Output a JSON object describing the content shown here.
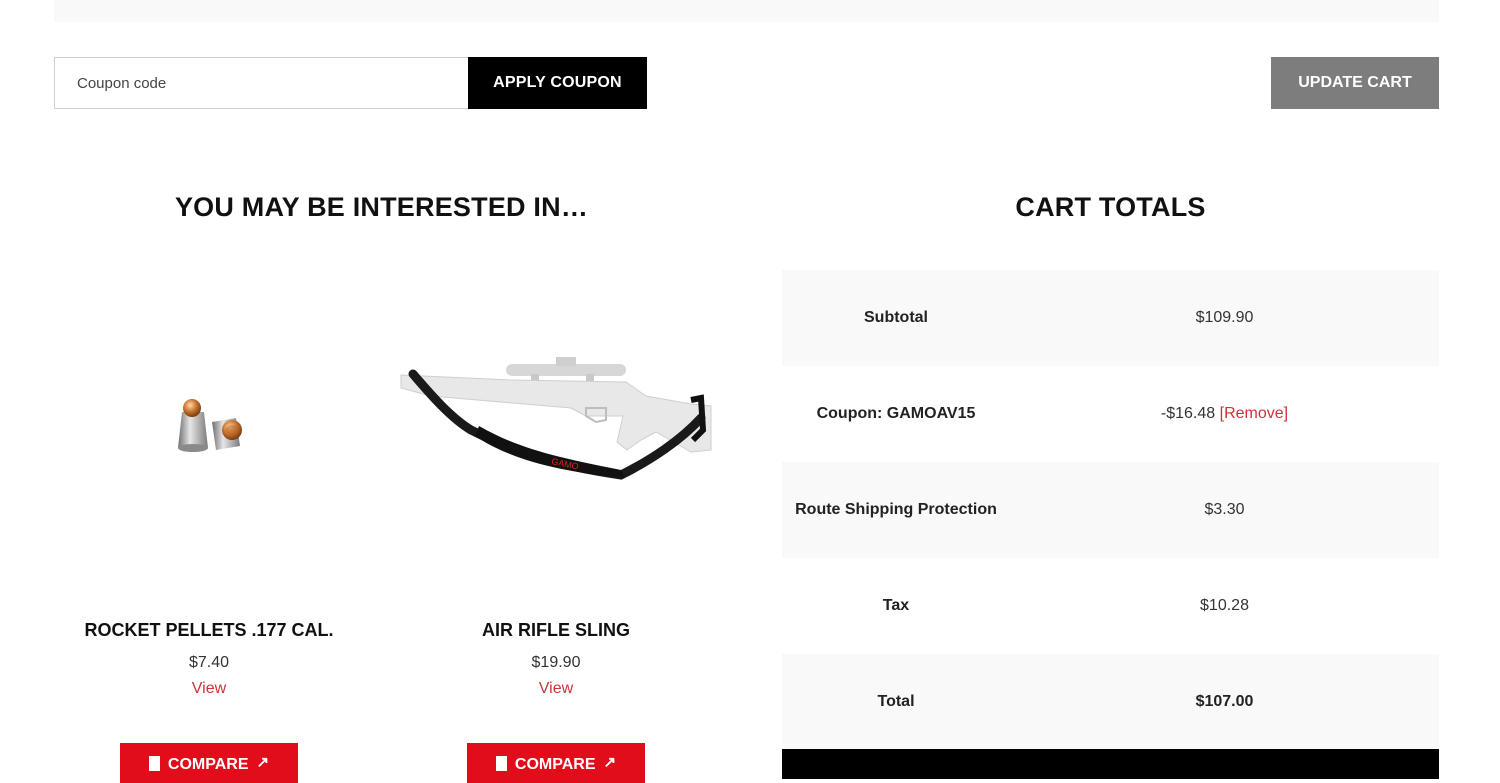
{
  "coupon": {
    "placeholder": "Coupon code",
    "apply_label": "APPLY COUPON",
    "update_label": "UPDATE CART"
  },
  "interested": {
    "title": "YOU MAY BE INTERESTED IN…",
    "products": [
      {
        "name": "ROCKET PELLETS .177 CAL.",
        "price": "$7.40",
        "view_label": "View",
        "compare_label": "COMPARE"
      },
      {
        "name": "AIR RIFLE SLING",
        "price": "$19.90",
        "view_label": "View",
        "compare_label": "COMPARE"
      }
    ]
  },
  "totals": {
    "title": "CART TOTALS",
    "subtotal_label": "Subtotal",
    "subtotal_value": "$109.90",
    "coupon_label": "Coupon: GAMOAV15",
    "coupon_value": "-$16.48",
    "remove_label": "[Remove]",
    "shipping_label": "Route Shipping Protection",
    "shipping_value": "$3.30",
    "tax_label": "Tax",
    "tax_value": "$10.28",
    "total_label": "Total",
    "total_value": "$107.00"
  },
  "colors": {
    "accent_red": "#e10d1a",
    "link_red": "#c8343a",
    "button_black": "#000000",
    "button_gray": "#7d7d7d",
    "row_alt": "#f9f9f9"
  }
}
